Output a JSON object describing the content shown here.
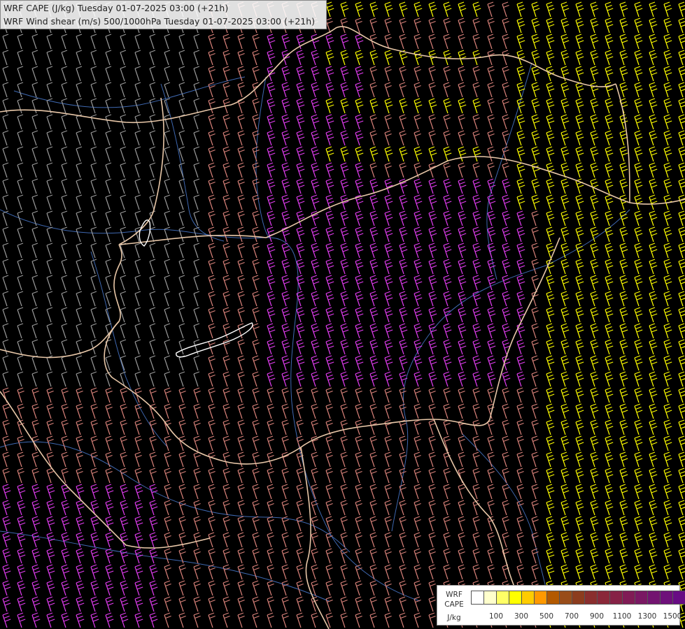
{
  "title": {
    "line1": "WRF CAPE (J/kg) Tuesday 01-07-2025 03:00 (+21h)",
    "line2": "WRF Wind shear (m/s) 500/1000hPa Tuesday 01-07-2025 03:00 (+21h)"
  },
  "legend": {
    "line1": "WRF",
    "line2": "CAPE",
    "unit": "J/kg",
    "colors": [
      "#ffffff",
      "#ffffcc",
      "#ffff66",
      "#ffff00",
      "#ffcc00",
      "#ff9900",
      "#b35900",
      "#994d1a",
      "#8c3c1e",
      "#8a2e2e",
      "#8a2839",
      "#862246",
      "#801c55",
      "#7a1863",
      "#731470",
      "#6e107a",
      "#680c84"
    ],
    "ticks": [
      "100",
      "300",
      "500",
      "700",
      "900",
      "1100",
      "1300",
      "1500"
    ]
  },
  "colors": {
    "background": "#000000",
    "border": "#e8c7a8",
    "rivers": "#4a7bd0",
    "barb_low": "#9a9a9a",
    "barb_mid": "#d9827a",
    "barb_high": "#e23cf0",
    "barb_yellow": "#ffff00"
  }
}
